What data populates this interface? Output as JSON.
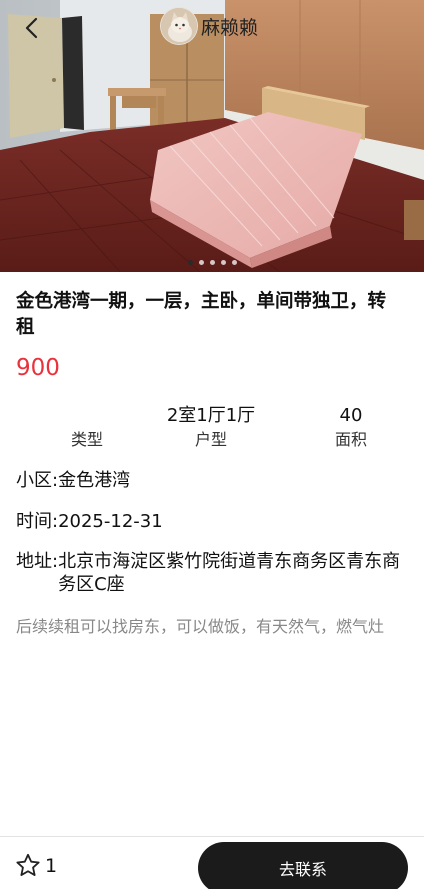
{
  "header": {
    "back_icon": "chevron-left-icon",
    "owner_name": "麻赖赖"
  },
  "gallery": {
    "total_images": 5,
    "active_index": 0
  },
  "listing": {
    "title": "金色港湾一期，一层，主卧，单间带独卫，转租",
    "price": "900",
    "specs": [
      {
        "value": "",
        "label": "类型"
      },
      {
        "value": "2室1厅1厅",
        "label": "户型"
      },
      {
        "value": "40",
        "label": "面积"
      }
    ],
    "community": "小区:金色港湾",
    "time": "时间:2025-12-31",
    "address_label": "地址:",
    "address_value": "北京市海淀区紫竹院街道青东商务区青东商务区C座",
    "description": "后续续租可以找房东，可以做饭，有天然气，燃气灶"
  },
  "bottom_bar": {
    "favorite_icon": "star-outline-icon",
    "favorite_count": "1",
    "contact_label": "去联系"
  },
  "colors": {
    "price": "#e8323c",
    "contact_button_bg": "#1b1b1b",
    "description_text": "#888888"
  }
}
